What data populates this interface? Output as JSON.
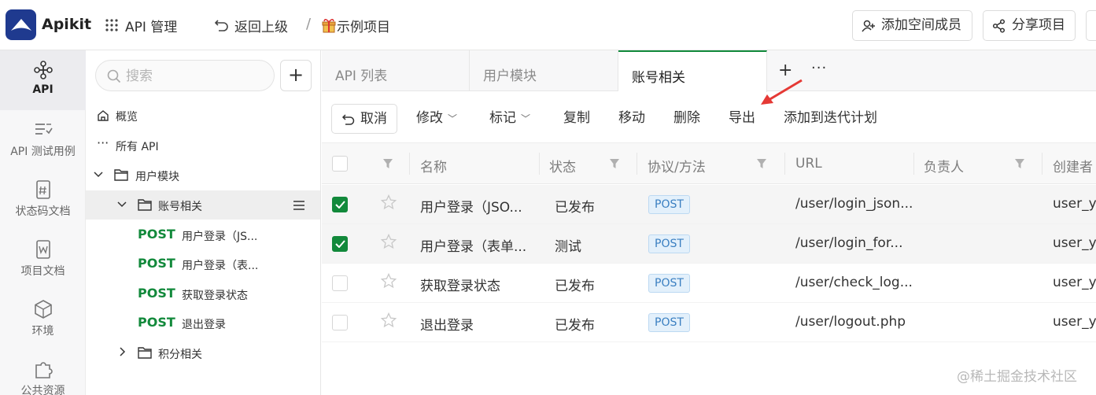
{
  "app": {
    "brand": "Apikit"
  },
  "topbar": {
    "api_manage": "API 管理",
    "back": "返回上级",
    "separator": "/",
    "project": "示例项目",
    "add_member": "添加空间成员",
    "share": "分享项目"
  },
  "rail": [
    {
      "label": "API",
      "icon": "api-icon",
      "active": true
    },
    {
      "label": "API 测试用例",
      "icon": "testcase-icon"
    },
    {
      "label": "状态码文档",
      "icon": "statuscode-icon"
    },
    {
      "label": "项目文档",
      "icon": "document-icon"
    },
    {
      "label": "环境",
      "icon": "environment-icon"
    },
    {
      "label": "公共资源",
      "icon": "puzzle-icon"
    }
  ],
  "tree": {
    "search_placeholder": "搜索",
    "overview": "概览",
    "all_api": "所有 API",
    "group_user": "用户模块",
    "group_account": "账号相关",
    "group_points": "积分相关",
    "items": [
      {
        "method": "POST",
        "name": "用户登录（JS..."
      },
      {
        "method": "POST",
        "name": "用户登录（表..."
      },
      {
        "method": "POST",
        "name": "获取登录状态"
      },
      {
        "method": "POST",
        "name": "退出登录"
      }
    ]
  },
  "tabs": [
    "API 列表",
    "用户模块",
    "账号相关"
  ],
  "toolbar": {
    "cancel": "取消",
    "modify": "修改",
    "mark": "标记",
    "copy": "复制",
    "move": "移动",
    "delete": "删除",
    "export": "导出",
    "add_iteration": "添加到迭代计划"
  },
  "table": {
    "headers": [
      "名称",
      "状态",
      "协议/方法",
      "URL",
      "负责人",
      "创建者"
    ],
    "rows": [
      {
        "checked": true,
        "name": "用户登录（JSO...",
        "status": "已发布",
        "status_type": "published",
        "method": "POST",
        "url": "/user/login_json...",
        "creator": "user_ya"
      },
      {
        "checked": true,
        "name": "用户登录（表单...",
        "status": "测试",
        "status_type": "testing",
        "method": "POST",
        "url": "/user/login_for...",
        "creator": "user_ya"
      },
      {
        "checked": false,
        "name": "获取登录状态",
        "status": "已发布",
        "status_type": "published",
        "method": "POST",
        "url": "/user/check_log...",
        "creator": "user_ya"
      },
      {
        "checked": false,
        "name": "退出登录",
        "status": "已发布",
        "status_type": "published",
        "method": "POST",
        "url": "/user/logout.php",
        "creator": "user_ya"
      }
    ]
  },
  "watermark": "@稀土掘金技术社区",
  "colors": {
    "brand": "#1f3a8f",
    "accent": "#12893b",
    "testing": "#d98a12",
    "method_badge": "#3a7fc1",
    "annotation_arrow": "#e53935"
  }
}
